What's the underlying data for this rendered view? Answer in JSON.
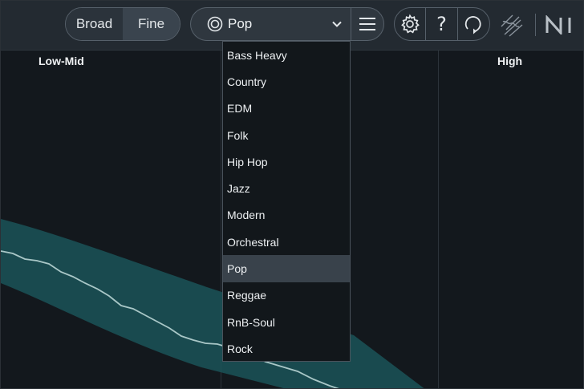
{
  "toolbar": {
    "segmented": {
      "broad_label": "Broad",
      "fine_label": "Fine",
      "selected": "Fine"
    },
    "preset": {
      "value": "Pop",
      "target_icon": "target-icon",
      "chevron_icon": "chevron-down-icon"
    },
    "menu_icon": "hamburger-menu-icon",
    "icons": {
      "settings": "gear-icon",
      "help": "?",
      "help_icon": "question-icon",
      "history": "history-icon"
    },
    "logos": {
      "first": "izotope-logo",
      "second": "ni-logo"
    }
  },
  "bands": {
    "low_mid": "Low-Mid",
    "high": "High"
  },
  "dropdown": {
    "items": [
      "Bass Heavy",
      "Country",
      "EDM",
      "Folk",
      "Hip Hop",
      "Jazz",
      "Modern",
      "Orchestral",
      "Pop",
      "Reggae",
      "RnB-Soul",
      "Rock"
    ],
    "selected": "Pop"
  },
  "colors": {
    "toolbar_bg": "#232a31",
    "content_bg": "#13181d",
    "curve_band": "#1b5458",
    "curve_line": "#a9c7c7",
    "selected_item": "#39424b"
  }
}
